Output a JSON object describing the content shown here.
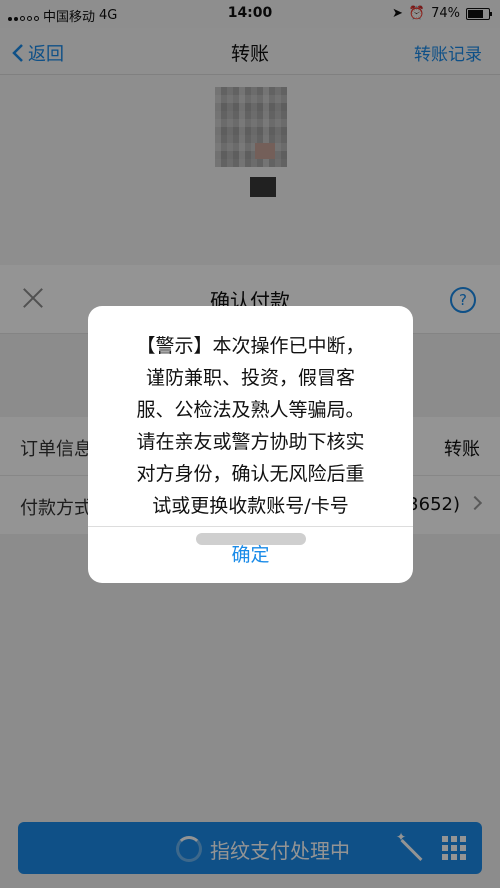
{
  "status_bar": {
    "carrier": "中国移动",
    "network": "4G",
    "time": "14:00",
    "battery": "74%",
    "battery_level": 0.74
  },
  "nav": {
    "back": "返回",
    "title": "转账",
    "right": "转账记录"
  },
  "sheet": {
    "title": "确认付款",
    "help": "?",
    "order_label": "订单信息",
    "order_value": "转账",
    "pay_label": "付款方式",
    "pay_value": "(3652)",
    "pay_button": "指纹支付处理中"
  },
  "dialog": {
    "message_lines": [
      "【警示】本次操作已中断，",
      "谨防兼职、投资，假冒客",
      "服、公检法及熟人等骗局。",
      "请在亲友或警方协助下核实",
      "对方身份，确认无风险后重",
      "试或更换收款账号/卡号"
    ],
    "confirm": "确定"
  },
  "colors": {
    "accent": "#1a8be8",
    "overlay": "rgba(0,0,0,0.42)"
  }
}
